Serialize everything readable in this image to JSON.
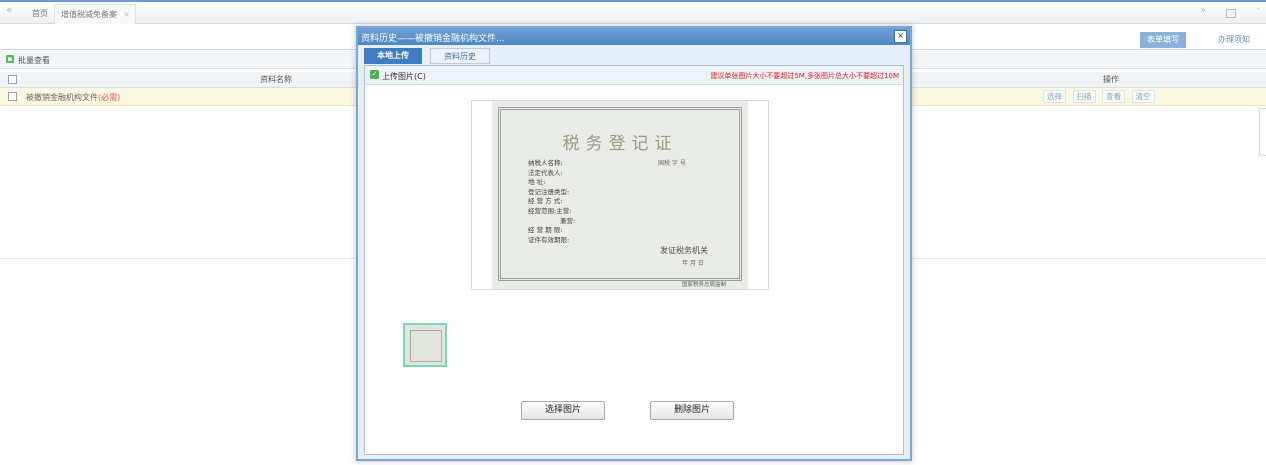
{
  "topbar": {
    "home_tab": "首页",
    "filing_tab": "增值税减免备案",
    "filing_tab_close": "×",
    "prev_glyph": "«",
    "next_glyph": "»"
  },
  "right_tabs": {
    "form_fill": "表单填写",
    "guide": "办理须知"
  },
  "batch": {
    "label": "批量查看"
  },
  "grid": {
    "col_name": "资料名称",
    "col_ops": "操作",
    "rows": [
      {
        "name": "被撤销金融机构文件",
        "required": "(必需)",
        "ops": [
          "选择",
          "扫描",
          "查看",
          "清空"
        ]
      }
    ]
  },
  "modal": {
    "title": "资料历史——被撤销金融机构文件...",
    "close_glyph": "×",
    "tabs": [
      "本地上传",
      "资料历史"
    ],
    "upload_label": "上传图片(C)",
    "hint": "建议单张图片大小不要超过5M,多张图片总大小不要超过10M",
    "buttons": {
      "select": "选择图片",
      "delete": "删除图片"
    }
  },
  "certificate": {
    "title": "税务登记证",
    "number_label": "国税  字          号",
    "fields": [
      "纳税人名称:",
      "法定代表人:",
      "地      址:",
      "登记注册类型:",
      "经 营 方 式:",
      "经营范围:主营:",
      "兼营:",
      "经 营 期 限:",
      "证件有效期限:"
    ],
    "office": "发证税务机关",
    "date": "年    月    日",
    "footer": "国家税务总局监制"
  },
  "colors": {
    "accent": "#4f86c4",
    "tab_active": "#3f7dc2",
    "hint_red": "#e02020",
    "thumb_border": "#78d8b8"
  }
}
